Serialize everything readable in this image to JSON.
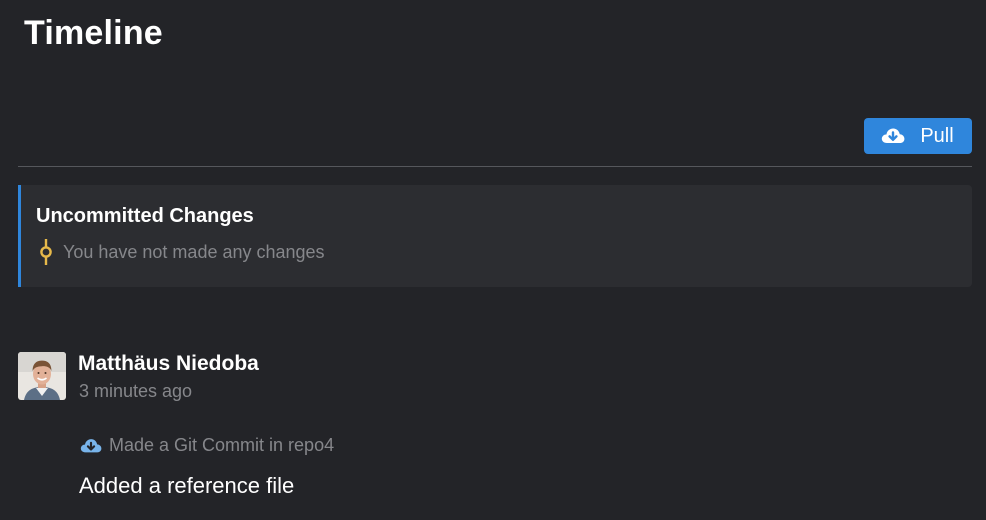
{
  "header": {
    "title": "Timeline"
  },
  "toolbar": {
    "pull_label": "Pull",
    "pull_icon": "cloud-download-icon"
  },
  "uncommitted": {
    "title": "Uncommitted Changes",
    "status": "You have not made any changes",
    "icon": "commit-node-icon"
  },
  "activity": [
    {
      "author": "Matthäus Niedoba",
      "time": "3 minutes ago",
      "event": "Made a Git Commit in repo4",
      "event_icon": "cloud-download-icon",
      "message": "Added a reference file"
    }
  ],
  "colors": {
    "background": "#232428",
    "card": "#2c2d31",
    "accent": "#2f86dc",
    "commit_node": "#e7b94a",
    "muted_text": "#86878b"
  }
}
